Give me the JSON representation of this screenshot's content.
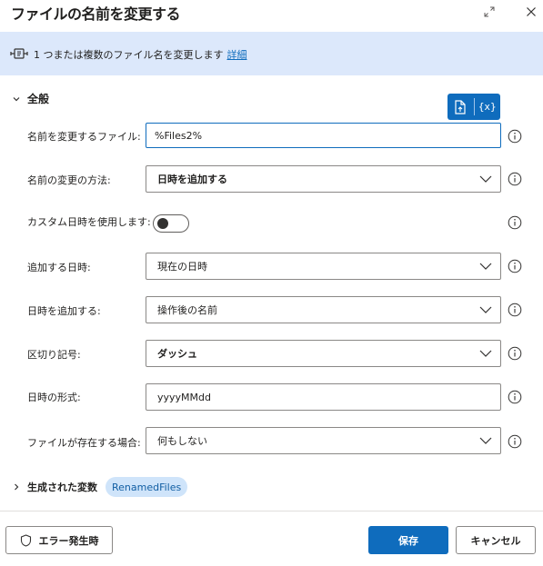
{
  "dialog": {
    "title": "ファイルの名前を変更する"
  },
  "info": {
    "description": "1 つまたは複数のファイル名を変更します",
    "link": "詳細"
  },
  "section": {
    "title": "全般"
  },
  "fields": {
    "files_label": "名前を変更するファイル:",
    "files_value": "%Files2%",
    "method_label": "名前の変更の方法:",
    "method_value": "日時を追加する",
    "custom_label": "カスタム日時を使用します:",
    "custom_on": false,
    "datetime_add_label": "追加する日時:",
    "datetime_add_value": "現在の日時",
    "add_datetime_label": "日時を追加する:",
    "add_datetime_value": "操作後の名前",
    "separator_label": "区切り記号:",
    "separator_value": "ダッシュ",
    "format_label": "日時の形式:",
    "format_value": "yyyyMMdd",
    "exists_label": "ファイルが存在する場合:",
    "exists_value": "何もしない"
  },
  "variables": {
    "title": "生成された変数",
    "chip": "RenamedFiles"
  },
  "footer": {
    "error_label": "エラー発生時",
    "save_label": "保存",
    "cancel_label": "キャンセル"
  },
  "colors": {
    "accent": "#0f6cbd",
    "infobar": "#dce8fb",
    "chip": "#cfe4fa"
  },
  "icons": {
    "expand": "expand-icon",
    "close": "close-icon",
    "action": "action-icon",
    "file": "file-icon",
    "variable": "variable-icon",
    "info": "info-icon",
    "shield": "shield-icon"
  }
}
